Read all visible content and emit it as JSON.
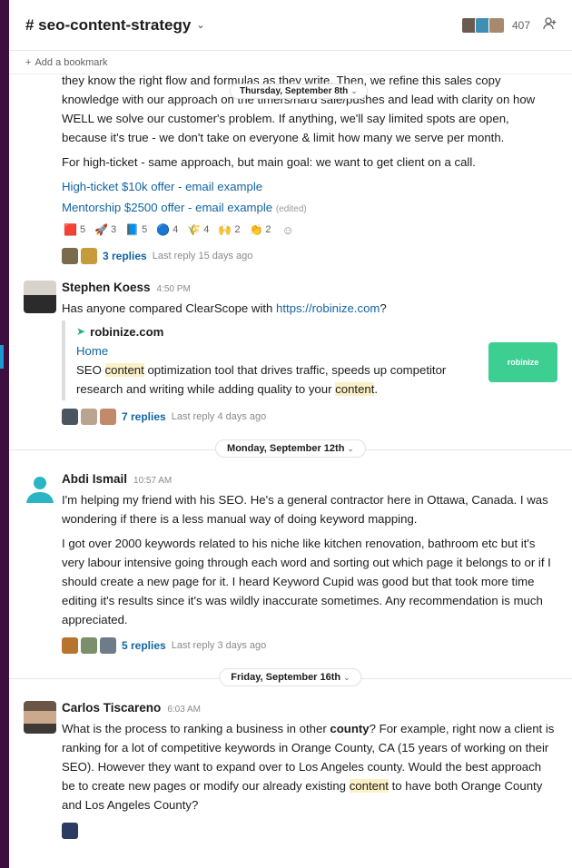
{
  "channel": {
    "name": "# seo-content-strategy",
    "member_count": "407"
  },
  "bookmark": {
    "label": "Add a bookmark"
  },
  "floating_date": "Thursday, September 8th",
  "message0": {
    "para1": "they know the right flow and formulas as they write. Then, we refine this sales copy knowledge with our approach on the timers/hard sale/pushes and lead with clarity on how WELL we solve our customer's problem. If anything, we'll say limited spots are open, because it's true - we don't take on everyone & limit how many we serve per month.",
    "para2": "For high-ticket - same approach, but main goal: we want to get client on a call.",
    "link1": "High-ticket $10k offer - email example",
    "link2": "Mentorship $2500 offer - email example",
    "edited": "(edited)",
    "reactions": [
      {
        "emoji": "🟥",
        "count": "5"
      },
      {
        "emoji": "🚀",
        "count": "3"
      },
      {
        "emoji": "📘",
        "count": "5"
      },
      {
        "emoji": "🔵",
        "count": "4"
      },
      {
        "emoji": "🌾",
        "count": "4"
      },
      {
        "emoji": "🙌",
        "count": "2"
      },
      {
        "emoji": "👏",
        "count": "2"
      }
    ],
    "replies": "3 replies",
    "last_reply": "Last reply 15 days ago"
  },
  "message1": {
    "name": "Stephen Koess",
    "time": "4:50 PM",
    "text_pre": "Has anyone compared ClearScope with ",
    "text_link": "https://robinize.com",
    "text_post": "?",
    "unfurl": {
      "site": "robinize.com",
      "title": "Home",
      "desc_1": "SEO ",
      "desc_hl1": "content",
      "desc_2": " optimization tool that drives traffic, speeds up competitor research and writing while adding quality to your ",
      "desc_hl2": "content",
      "desc_3": ".",
      "thumb": "robinize"
    },
    "replies": "7 replies",
    "last_reply": "Last reply 4 days ago"
  },
  "divider1": "Monday, September 12th",
  "message2": {
    "name": "Abdi Ismail",
    "time": "10:57 AM",
    "para1": "I'm helping my friend with his SEO. He's a general contractor here in Ottawa, Canada. I was wondering if there is a less manual way of doing keyword mapping.",
    "para2": "I got over 2000 keywords related to his niche like kitchen renovation, bathroom etc but it's very labour intensive going through each word and sorting out which page it belongs to or if I should create a new page for it. I heard Keyword Cupid was good but that took more time editing it's results since it's was wildly inaccurate sometimes. Any recommendation is much appreciated.",
    "replies": "5 replies",
    "last_reply": "Last reply 3 days ago"
  },
  "divider2": "Friday, September 16th",
  "message3": {
    "name": "Carlos Tiscareno",
    "time": "6:03 AM",
    "t1": "What is the process to ranking a business in other ",
    "t_bold": "county",
    "t2": "? For example, right now a client is ranking for a lot of competitive keywords in Orange County, CA (15 years of working on their SEO). However they want to expand over to Los Angeles county. Would the best approach be to create new pages or modify our already existing ",
    "t_hl": "content",
    "t3": " to have both Orange County and Los Angeles County?"
  }
}
